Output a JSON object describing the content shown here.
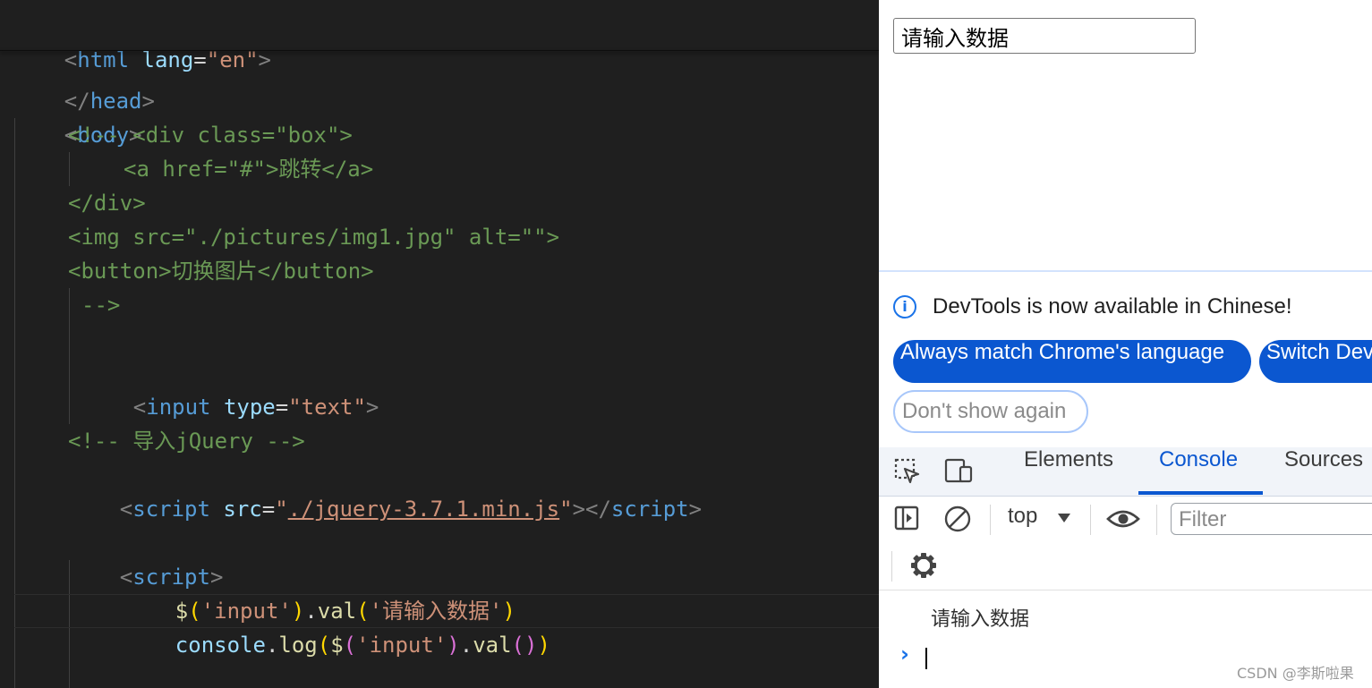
{
  "editor": {
    "lines": {
      "l0": {
        "p1": "<",
        "tag": "html",
        "attr": "lang",
        "eq": "=",
        "val": "\"en\"",
        "p2": ">"
      },
      "l1": {
        "p1": "</",
        "tag": "head",
        "p2": ">"
      },
      "l2": {
        "p1": "<",
        "tag": "body",
        "p2": ">"
      },
      "l3": "<!-- <div class=\"box\">",
      "l4": "<a href=\"#\">跳转</a>",
      "l5": "</div>",
      "l6": "<img src=\"./pictures/img1.jpg\" alt=\"\">",
      "l7": "<button>切换图片</button>",
      "l8": "-->",
      "l9": {
        "p1": "<",
        "tag": "input",
        "attr": "type",
        "eq": "=",
        "val": "\"text\"",
        "p2": ">"
      },
      "l10": "<!-- 导入jQuery -->",
      "l11": {
        "p1": "<",
        "tag": "script",
        "attr": "src",
        "eq": "=",
        "q1": "\"",
        "link": "./jquery-3.7.1.min.js",
        "q2": "\"",
        "p2": "></",
        "tag2": "script",
        "p3": ">"
      },
      "l12": {
        "p1": "<",
        "tag": "script",
        "p2": ">"
      },
      "l13": {
        "dollar": "$",
        "b1": "(",
        "s1": "'input'",
        "b1c": ")",
        "dot": ".",
        "fn": "val",
        "b2": "(",
        "s2": "'请输入数据'",
        "b2c": ")"
      },
      "l14": {
        "obj": "console",
        "dot": ".",
        "fn": "log",
        "b1": "(",
        "dollar": "$",
        "b2": "(",
        "s1": "'input'",
        "b2c": ")",
        "dot2": ".",
        "fn2": "val",
        "b3": "()",
        "b1c": ")"
      }
    }
  },
  "page": {
    "input_value": "请输入数据"
  },
  "devtools": {
    "banner": {
      "message": "DevTools is now available in Chinese!",
      "btn_always": "Always match Chrome's language",
      "btn_switch": "Switch Dev",
      "btn_dont": "Don't show again"
    },
    "tabs": {
      "elements": "Elements",
      "console": "Console",
      "sources": "Sources"
    },
    "toolbar": {
      "context": "top",
      "filter_placeholder": "Filter"
    },
    "console": {
      "log": "请输入数据",
      "prompt": "›"
    }
  },
  "watermark": "CSDN @李斯啦果",
  "colors": {
    "accent": "#0b57d0",
    "editor_bg": "#1f1f1f"
  }
}
